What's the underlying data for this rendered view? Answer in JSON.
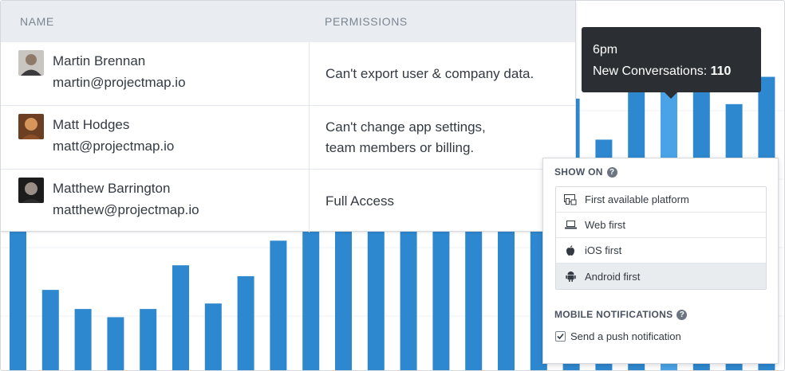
{
  "users_table": {
    "columns": {
      "name": "NAME",
      "permissions": "PERMISSIONS"
    },
    "rows": [
      {
        "name": "Martin Brennan",
        "email": "martin@projectmap.io",
        "permissions": "Can't export user & company data."
      },
      {
        "name": "Matt Hodges",
        "email": "matt@projectmap.io",
        "permissions": "Can't change app settings,\nteam members or billing."
      },
      {
        "name": "Matthew Barrington",
        "email": "matthew@projectmap.io",
        "permissions": "Full Access"
      }
    ]
  },
  "tooltip": {
    "time": "6pm",
    "label": "New Conversations:",
    "value": "110"
  },
  "show_on": {
    "title": "SHOW ON",
    "help_icon": "?",
    "options": [
      {
        "label": "First available platform",
        "icon": "multi-device-icon",
        "selected": false
      },
      {
        "label": "Web first",
        "icon": "laptop-icon",
        "selected": false
      },
      {
        "label": "iOS first",
        "icon": "apple-icon",
        "selected": false
      },
      {
        "label": "Android first",
        "icon": "android-icon",
        "selected": true
      }
    ]
  },
  "mobile_notifications": {
    "title": "MOBILE NOTIFICATIONS",
    "help_icon": "?",
    "push_label": "Send a push notification",
    "push_checked": true
  },
  "chart_data": {
    "type": "bar",
    "bar_color": "#2e88cf",
    "highlight_color": "#4aa3e6",
    "highlighted_index": 20,
    "ylim": [
      0,
      130
    ],
    "values": [
      74,
      30,
      23,
      20,
      23,
      39,
      25,
      35,
      48,
      80,
      73,
      71,
      83,
      78,
      100,
      100,
      100,
      100,
      85,
      110,
      108,
      110,
      98,
      108,
      108
    ]
  }
}
